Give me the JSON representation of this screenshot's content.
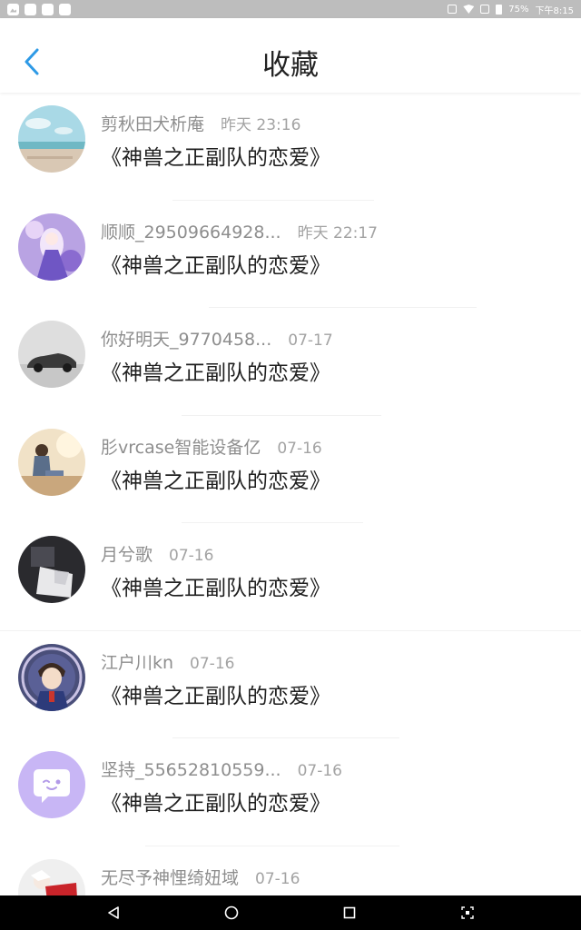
{
  "status_bar": {
    "battery": "75%",
    "time": "下午8:15"
  },
  "header": {
    "title": "收藏"
  },
  "favorites": [
    {
      "user": "剪秋田犬析庵",
      "time": "昨天 23:16",
      "book": "《神兽之正副队的恋爱》",
      "avatar": "beach-avatar"
    },
    {
      "user": "顺顺_29509664928...",
      "time": "昨天 22:17",
      "book": "《神兽之正副队的恋爱》",
      "avatar": "anime-girl-avatar"
    },
    {
      "user": "你好明天_9770458...",
      "time": "07-17",
      "book": "《神兽之正副队的恋爱》",
      "avatar": "car-avatar"
    },
    {
      "user": "肜vrcase智能设备亿",
      "time": "07-16",
      "book": "《神兽之正副队的恋爱》",
      "avatar": "sitting-person-avatar"
    },
    {
      "user": "月兮歌",
      "time": "07-16",
      "book": "《神兽之正副队的恋爱》",
      "avatar": "hand-avatar"
    },
    {
      "user": "江户川kn",
      "time": "07-16",
      "book": "《神兽之正副队的恋爱》",
      "avatar": "detective-avatar"
    },
    {
      "user": "坚持_55652810559...",
      "time": "07-16",
      "book": "《神兽之正副队的恋爱》",
      "avatar": "default-chat-avatar"
    },
    {
      "user": "无尽予神悝绮妞域",
      "time": "07-16",
      "book": "",
      "avatar": "red-figure-avatar"
    }
  ],
  "colors": {
    "accent": "#2e9ae6",
    "default_avatar_bg": "#c8b6f5"
  }
}
